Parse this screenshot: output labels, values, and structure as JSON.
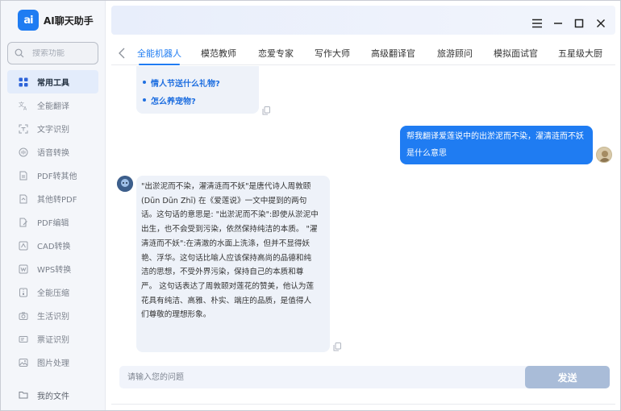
{
  "app": {
    "logo_mark": "ai",
    "title": "AI聊天助手"
  },
  "search": {
    "placeholder": "搜索功能"
  },
  "sidebar": {
    "items": [
      {
        "label": "常用工具",
        "icon": "grid-icon",
        "active": true
      },
      {
        "label": "全能翻译",
        "icon": "translate-icon"
      },
      {
        "label": "文字识别",
        "icon": "scan-text-icon"
      },
      {
        "label": "语音转换",
        "icon": "voice-icon"
      },
      {
        "label": "PDF转其他",
        "icon": "pdf-convert-icon"
      },
      {
        "label": "其他转PDF",
        "icon": "to-pdf-icon"
      },
      {
        "label": "PDF编辑",
        "icon": "pdf-edit-icon"
      },
      {
        "label": "CAD转换",
        "icon": "cad-icon"
      },
      {
        "label": "WPS转换",
        "icon": "wps-icon"
      },
      {
        "label": "全能压缩",
        "icon": "compress-icon"
      },
      {
        "label": "生活识别",
        "icon": "camera-icon"
      },
      {
        "label": "票证识别",
        "icon": "ticket-icon"
      },
      {
        "label": "图片处理",
        "icon": "image-icon"
      }
    ],
    "my_files": "我的文件"
  },
  "tabs": [
    {
      "label": "全能机器人",
      "active": true
    },
    {
      "label": "模范教师"
    },
    {
      "label": "恋爱专家"
    },
    {
      "label": "写作大师"
    },
    {
      "label": "高级翻译官"
    },
    {
      "label": "旅游顾问"
    },
    {
      "label": "模拟面试官"
    },
    {
      "label": "五星级大厨"
    }
  ],
  "chat": {
    "suggestions": [
      "情人节送什么礼物?",
      "怎么养宠物?"
    ],
    "user_message": "帮我翻译爱莲说中的出淤泥而不染，濯清涟而不妖是什么意思",
    "bot_message_lines": [
      "\"出淤泥而不染，濯清涟而不妖\"是唐代诗人周敦颐",
      "(Dūn Dūn Zhī) 在《爱莲说》一文中提到的两句",
      "话。这句话的意思是: \"出淤泥而不染\":即使从淤泥中",
      "出生，也不会受到污染，依然保持纯洁的本质。 \"濯",
      "清涟而不妖\":在清澈的水面上洗涤，但并不显得妖",
      "艳、浮华。这句话比喻人应该保持高尚的品德和纯",
      "洁的思想，不受外界污染，保持自己的本质和尊",
      "严。 这句话表达了周敦颐对莲花的赞美，他认为莲",
      "花具有纯洁、高雅、朴实、端庄的品质，是值得人",
      "们尊敬的理想形象。"
    ]
  },
  "input": {
    "placeholder": "请输入您的问题",
    "send_label": "发送"
  },
  "colors": {
    "accent": "#1f7cf2",
    "send_disabled": "#a9bcd8",
    "bubble_bot": "#eef2f9"
  }
}
